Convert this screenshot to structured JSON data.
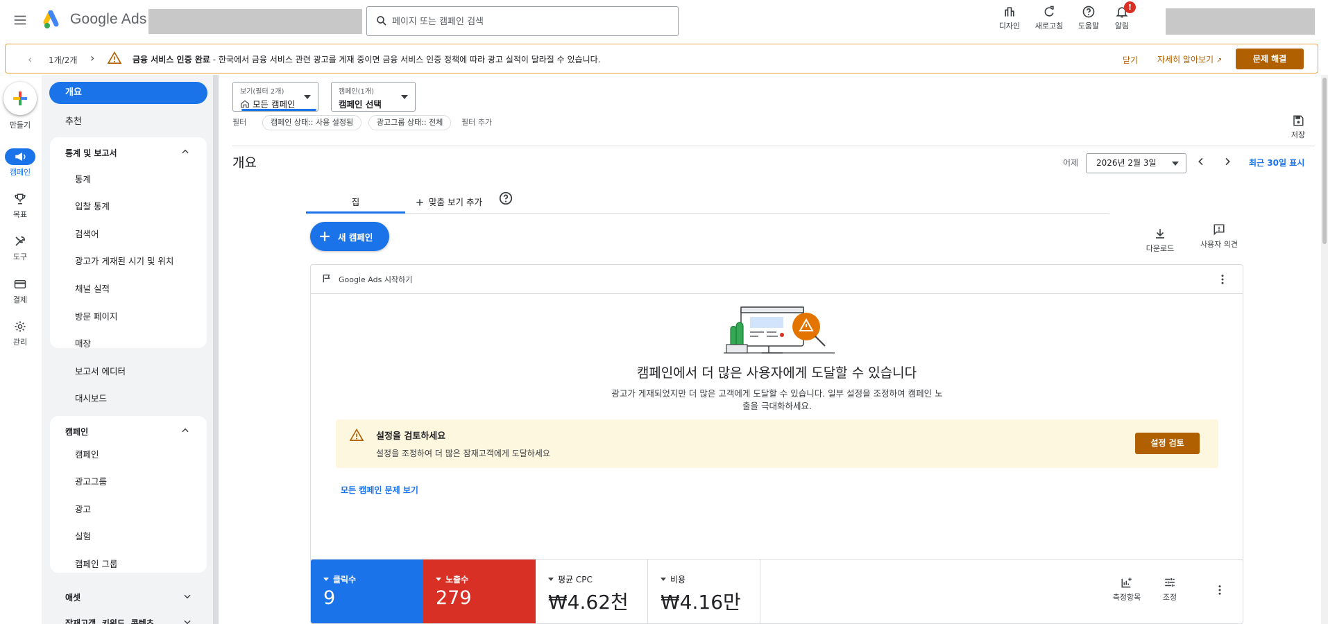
{
  "header": {
    "product_name": "Google Ads",
    "search_placeholder": "페이지 또는 캠페인 검색",
    "actions": [
      {
        "label": "디자인",
        "icon": "appearance-icon"
      },
      {
        "label": "새로고침",
        "icon": "refresh-icon"
      },
      {
        "label": "도움말",
        "icon": "help-icon"
      },
      {
        "label": "알림",
        "icon": "bell-icon",
        "badge": "!"
      }
    ]
  },
  "notice": {
    "counter": "1개/2개",
    "title": "금융 서비스 인증 완료",
    "message": " - 한국에서 금융 서비스 관련 광고를 게재 중이면 금융 서비스 인증 정책에 따라 광고 실적이 달라질 수 있습니다.",
    "close_label": "닫기",
    "learn_more_label": "자세히 알아보기",
    "fix_label": "문제 해결"
  },
  "rail": {
    "create_label": "만들기",
    "items": [
      {
        "label": "캠페인",
        "icon": "megaphone-icon",
        "active": true
      },
      {
        "label": "목표",
        "icon": "trophy-icon"
      },
      {
        "label": "도구",
        "icon": "tools-icon"
      },
      {
        "label": "결제",
        "icon": "credit-card-icon"
      },
      {
        "label": "관리",
        "icon": "gear-icon"
      }
    ]
  },
  "nav": {
    "overview": "개요",
    "recommendations": "추천",
    "stats_section": {
      "title": "통계 및 보고서",
      "items": [
        "통계",
        "입찰 통계",
        "검색어",
        "광고가 게재된 시기 및 위치",
        "채널 실적",
        "방문 페이지",
        "매장",
        "보고서 에디터",
        "대시보드"
      ]
    },
    "campaign_section": {
      "title": "캠페인",
      "items": [
        "캠페인",
        "광고그룹",
        "광고",
        "실험",
        "캠페인 그룹"
      ]
    },
    "assets_section": "애셋",
    "audience_section": "잠재고객, 키워드, 콘텐츠"
  },
  "main": {
    "view_filter": {
      "label": "보기(필터 2개)",
      "value": "모든 캠페인"
    },
    "campaign_filter": {
      "label": "캠페인(1개)",
      "value": "캠페인 선택"
    },
    "filter_label": "필터",
    "chips": [
      "캠페인 상태:: 사용 설정됨",
      "광고그룹 상태:: 전체"
    ],
    "add_filter_label": "필터 추가",
    "save_label": "저장",
    "page_title": "개요",
    "date_prefix": "어제",
    "date_value": "2026년 2월 3일",
    "date_range_link": "최근 30일 표시",
    "tabs": {
      "home": "집",
      "add_custom": "맞춤 보기 추가"
    },
    "new_campaign_label": "새 캠페인",
    "download_label": "다운로드",
    "feedback_label": "사용자 의견"
  },
  "getting_started": {
    "header": "Google Ads 시작하기",
    "title": "캠페인에서 더 많은 사용자에게 도달할 수 있습니다",
    "description": "광고가 게재되었지만 더 많은 고객에게 도달할 수 있습니다. 일부 설정을 조정하여 캠페인 노출을 극대화하세요.",
    "review": {
      "title": "설정을 검토하세요",
      "subtitle": "설정을 조정하여 더 많은 잠재고객에게 도달하세요",
      "button": "설정 검토"
    },
    "view_all_issues": "모든 캠페인 문제 보기"
  },
  "metrics": {
    "items": [
      {
        "label": "클릭수",
        "value": "9",
        "color": "#1a73e8"
      },
      {
        "label": "노출수",
        "value": "279",
        "color": "#d93025"
      },
      {
        "label": "평균 CPC",
        "value": "₩4.62천"
      },
      {
        "label": "비용",
        "value": "₩4.16만"
      }
    ],
    "measures_label": "측정항목",
    "adjust_label": "조정"
  },
  "colors": {
    "primary": "#1a73e8",
    "warning": "#b06000",
    "danger": "#d93025",
    "notice_bg": "#fef7e0"
  }
}
